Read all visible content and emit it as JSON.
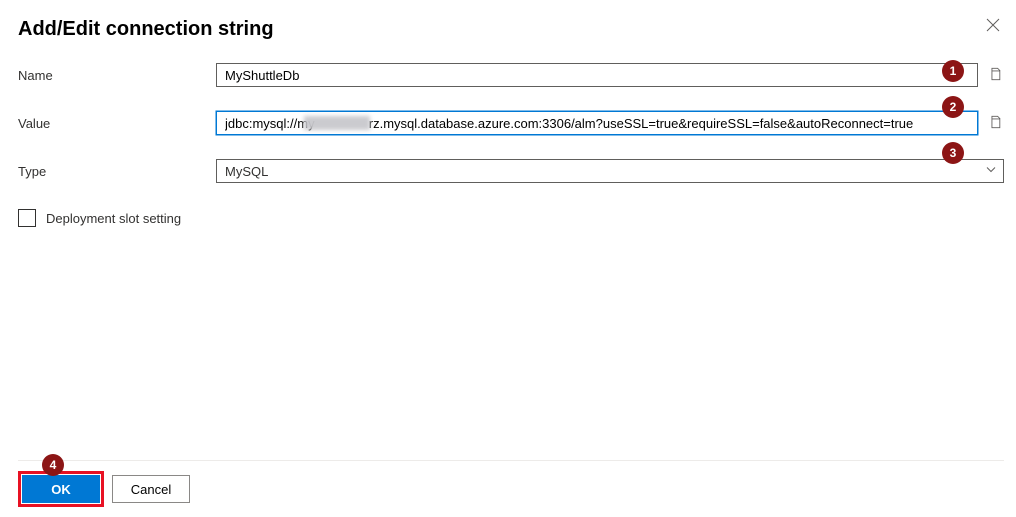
{
  "header": {
    "title": "Add/Edit connection string"
  },
  "fields": {
    "name": {
      "label": "Name",
      "value": "MyShuttleDb"
    },
    "value": {
      "label": "Value",
      "value": "jdbc:mysql://my               rz.mysql.database.azure.com:3306/alm?useSSL=true&requireSSL=false&autoReconnect=true"
    },
    "type": {
      "label": "Type",
      "selected": "MySQL"
    }
  },
  "deployment_slot_setting": {
    "label": "Deployment slot setting",
    "checked": false
  },
  "footer": {
    "ok": "OK",
    "cancel": "Cancel"
  },
  "markers": {
    "one": "1",
    "two": "2",
    "three": "3",
    "four": "4"
  }
}
